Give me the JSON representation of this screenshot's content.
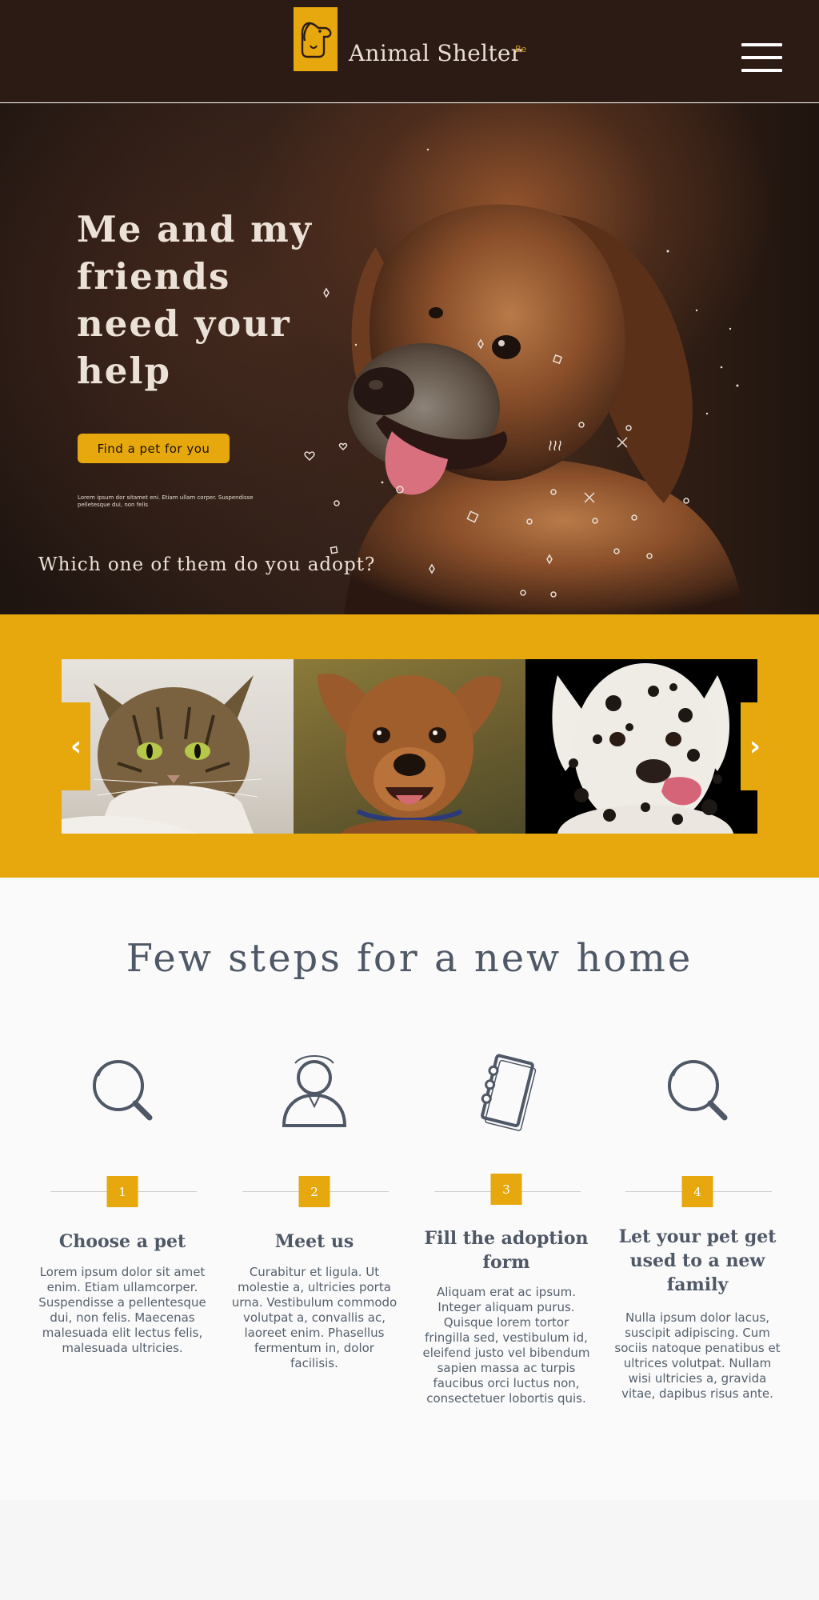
{
  "header": {
    "brand": "Animal Shelter",
    "brand_sup": "Be",
    "menu_icon": "hamburger-icon",
    "colors": {
      "background": "#2b1b14",
      "accent": "#e6a80c"
    }
  },
  "hero": {
    "title": "Me and my friends need your help",
    "cta_label": "Find a pet for you",
    "small_text": "Lorem ipsum dor sitamet eni. Etiam ullam corper. Suspendisse  pelletesque dui, non felis",
    "question": "Which one of them do you adopt?"
  },
  "carousel": {
    "slides": [
      "cat",
      "dog",
      "dalmatian"
    ],
    "prev_icon": "chevron-left-icon",
    "next_icon": "chevron-right-icon",
    "prev_glyph": "‹",
    "next_glyph": "›"
  },
  "steps": {
    "title": "Few steps for a new home",
    "items": [
      {
        "number": "1",
        "icon": "search-icon",
        "heading": "Choose a pet",
        "body": "Lorem ipsum dolor sit amet enim. Etiam ullamcorper. Suspendisse a pellentesque dui, non felis. Maecenas malesuada elit lectus felis, malesuada ultricies."
      },
      {
        "number": "2",
        "icon": "person-icon",
        "heading": "Meet us",
        "body": "Curabitur et ligula. Ut molestie a, ultricies porta urna. Vestibulum commodo volutpat a, convallis ac, laoreet enim. Phasellus fermentum in, dolor facilisis."
      },
      {
        "number": "3",
        "icon": "notebook-icon",
        "heading": "Fill the adoption form",
        "body": "Aliquam erat ac ipsum. Integer aliquam purus. Quisque lorem tortor fringilla sed, vestibulum id, eleifend justo vel bibendum sapien massa ac turpis faucibus orci luctus non, consectetuer lobortis quis."
      },
      {
        "number": "4",
        "icon": "search-icon",
        "heading": "Let your pet get used to a new family",
        "body": "Nulla ipsum dolor lacus, suscipit adipiscing. Cum sociis natoque penatibus et ultrices volutpat. Nullam wisi ultricies a, gravida vitae, dapibus risus ante."
      }
    ]
  }
}
